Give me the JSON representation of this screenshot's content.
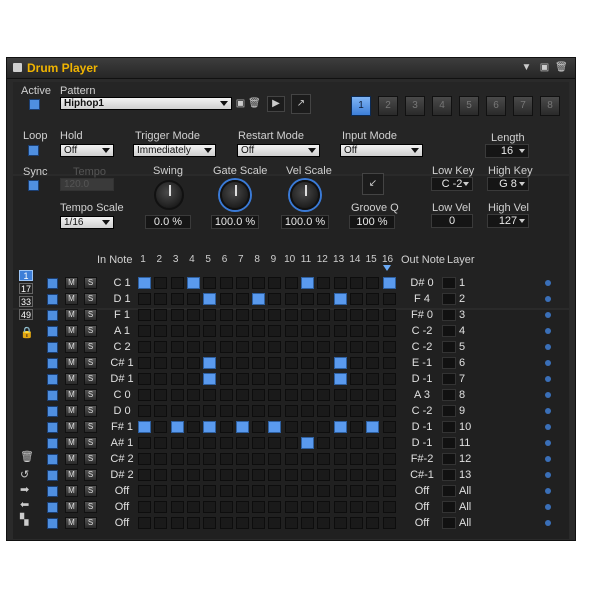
{
  "window": {
    "title": "Drum Player"
  },
  "top": {
    "active_label": "Active",
    "pattern_label": "Pattern",
    "pattern_value": "Hiphop1",
    "slots": [
      "1",
      "2",
      "3",
      "4",
      "5",
      "6",
      "7",
      "8"
    ],
    "selected_slot": "1"
  },
  "params": {
    "loop_label": "Loop",
    "sync_label": "Sync",
    "hold_label": "Hold",
    "hold_value": "Off",
    "tempo_label": "Tempo",
    "tempo_value": "120.0",
    "tempo_scale_label": "Tempo Scale",
    "tempo_scale_value": "1/16",
    "trigger_mode_label": "Trigger Mode",
    "trigger_mode_value": "Immediately",
    "restart_mode_label": "Restart Mode",
    "restart_mode_value": "Off",
    "input_mode_label": "Input Mode",
    "input_mode_value": "Off",
    "swing_label": "Swing",
    "swing_value": "0.0 %",
    "gate_scale_label": "Gate Scale",
    "gate_scale_value": "100.0 %",
    "vel_scale_label": "Vel Scale",
    "vel_scale_value": "100.0 %",
    "groove_q_label": "Groove Q",
    "groove_q_value": "100 %",
    "length_label": "Length",
    "length_value": "16",
    "low_key_label": "Low Key",
    "low_key_value": "C -2",
    "high_key_label": "High Key",
    "high_key_value": "G 8",
    "low_vel_label": "Low Vel",
    "low_vel_value": "0",
    "high_vel_label": "High Vel",
    "high_vel_value": "127"
  },
  "grid": {
    "in_note_label": "In Note",
    "out_note_label": "Out Note",
    "layer_label": "Layer",
    "steps": [
      "1",
      "2",
      "3",
      "4",
      "5",
      "6",
      "7",
      "8",
      "9",
      "10",
      "11",
      "12",
      "13",
      "14",
      "15",
      "16"
    ],
    "pattern_buttons": [
      "1",
      "17",
      "33",
      "49"
    ],
    "mute_label": "M",
    "solo_label": "S",
    "rows": [
      {
        "in": "C 1",
        "out": "D# 0",
        "layer": "1",
        "on": [
          1,
          4,
          11,
          16
        ]
      },
      {
        "in": "D 1",
        "out": "F 4",
        "layer": "2",
        "on": [
          5,
          8,
          13
        ]
      },
      {
        "in": "F 1",
        "out": "F# 0",
        "layer": "3",
        "on": []
      },
      {
        "in": "A 1",
        "out": "C -2",
        "layer": "4",
        "on": []
      },
      {
        "in": "C 2",
        "out": "C -2",
        "layer": "5",
        "on": []
      },
      {
        "in": "C# 1",
        "out": "E -1",
        "layer": "6",
        "on": [
          5,
          13
        ]
      },
      {
        "in": "D# 1",
        "out": "D -1",
        "layer": "7",
        "on": [
          5,
          13
        ]
      },
      {
        "in": "C 0",
        "out": "A 3",
        "layer": "8",
        "on": []
      },
      {
        "in": "D 0",
        "out": "C -2",
        "layer": "9",
        "on": []
      },
      {
        "in": "F# 1",
        "out": "D -1",
        "layer": "10",
        "on": [
          1,
          3,
          5,
          7,
          9,
          13,
          15
        ]
      },
      {
        "in": "A# 1",
        "out": "D -1",
        "layer": "11",
        "on": [
          11
        ]
      },
      {
        "in": "C# 2",
        "out": "F#-2",
        "layer": "12",
        "on": []
      },
      {
        "in": "D# 2",
        "out": "C#-1",
        "layer": "13",
        "on": []
      },
      {
        "in": "Off",
        "out": "Off",
        "layer": "All",
        "on": []
      },
      {
        "in": "Off",
        "out": "Off",
        "layer": "All",
        "on": []
      },
      {
        "in": "Off",
        "out": "Off",
        "layer": "All",
        "on": []
      }
    ]
  },
  "colors": {
    "accent": "#5a9aee",
    "title": "#f0b400",
    "bg": "#2a2a2a"
  }
}
